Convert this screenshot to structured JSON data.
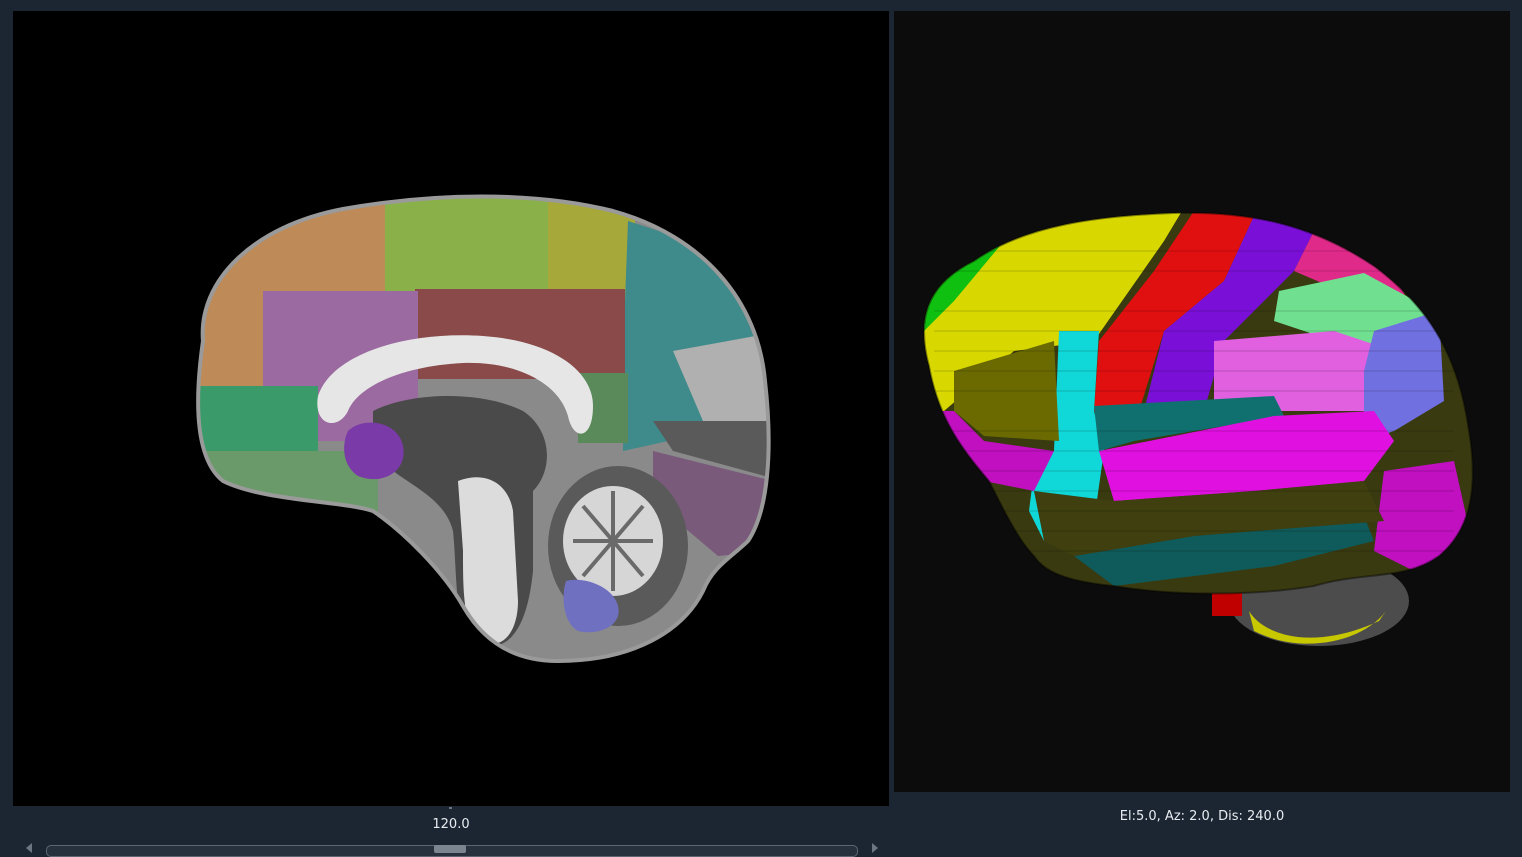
{
  "slice_view": {
    "slice_value": "120.0",
    "slider": {
      "value": 120.0
    }
  },
  "render_view": {
    "camera_readout": "El:5.0, Az: 2.0, Dis: 240.0"
  },
  "colors": {
    "background": "#1c2633",
    "slice_background": "#000000",
    "render_background": "#0c0c0c",
    "text": "#e8ecf0"
  }
}
